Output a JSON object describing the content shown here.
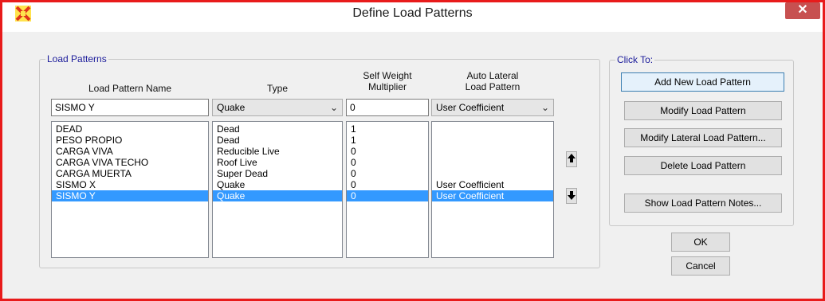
{
  "window": {
    "title": "Define Load Patterns",
    "close_glyph": "✕"
  },
  "group_load_patterns": {
    "label": "Load Patterns",
    "headers": {
      "name": "Load Pattern Name",
      "type": "Type",
      "mult_line1": "Self Weight",
      "mult_line2": "Multiplier",
      "auto_line1": "Auto Lateral",
      "auto_line2": "Load Pattern"
    },
    "edit": {
      "name": "SISMO Y",
      "type": "Quake",
      "multiplier": "0",
      "auto_lateral": "User Coefficient"
    },
    "rows": [
      {
        "name": "DEAD",
        "type": "Dead",
        "multiplier": "1",
        "auto_lateral": ""
      },
      {
        "name": "PESO PROPIO",
        "type": "Dead",
        "multiplier": "1",
        "auto_lateral": ""
      },
      {
        "name": "CARGA VIVA",
        "type": "Reducible Live",
        "multiplier": "0",
        "auto_lateral": ""
      },
      {
        "name": "CARGA VIVA TECHO",
        "type": "Roof Live",
        "multiplier": "0",
        "auto_lateral": ""
      },
      {
        "name": "CARGA MUERTA",
        "type": "Super Dead",
        "multiplier": "0",
        "auto_lateral": ""
      },
      {
        "name": "SISMO X",
        "type": "Quake",
        "multiplier": "0",
        "auto_lateral": "User Coefficient"
      },
      {
        "name": "SISMO Y",
        "type": "Quake",
        "multiplier": "0",
        "auto_lateral": "User Coefficient"
      }
    ],
    "selected_index": 6
  },
  "group_click_to": {
    "label": "Click To:",
    "add": "Add New Load Pattern",
    "modify": "Modify Load Pattern",
    "modify_lateral": "Modify Lateral Load Pattern...",
    "delete": "Delete Load Pattern",
    "notes": "Show Load Pattern Notes..."
  },
  "buttons": {
    "ok": "OK",
    "cancel": "Cancel"
  },
  "icons": {
    "app": "sap-app-icon",
    "up": "arrow-up-icon",
    "down": "arrow-down-icon"
  },
  "colors": {
    "window_border": "#e81b1b",
    "selection": "#3399ff",
    "group_label": "#1a1a9a"
  }
}
